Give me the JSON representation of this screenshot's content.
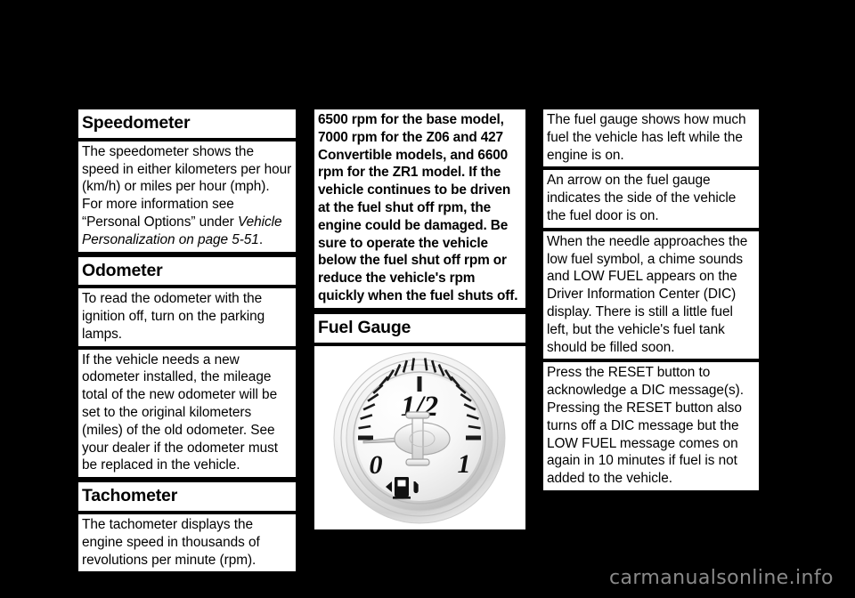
{
  "document": {
    "background_color": "#000000",
    "block_color": "#ffffff",
    "text_color": "#000000"
  },
  "columns": [
    {
      "id": "column-left",
      "blocks": [
        {
          "type": "heading",
          "text": "Speedometer"
        },
        {
          "type": "paragraph",
          "text": "The speedometer shows the speed in either kilometers per hour (km/h) or miles per hour (mph). For more information see “Personal Options” under ",
          "italic_text": "Vehicle Personalization on page 5-51",
          "text_after": "."
        },
        {
          "type": "heading",
          "text": "Odometer"
        },
        {
          "type": "paragraph",
          "text": "To read the odometer with the ignition off, turn on the parking lamps."
        },
        {
          "type": "paragraph",
          "text": "If the vehicle needs a new odometer installed, the mileage total of the new odometer will be set to the original kilometers (miles) of the old odometer. See your dealer if the odometer must be replaced in the vehicle."
        },
        {
          "type": "heading",
          "text": "Tachometer"
        },
        {
          "type": "paragraph",
          "text": "The tachometer displays the engine speed in thousands of revolutions per minute (rpm)."
        }
      ]
    },
    {
      "id": "column-center",
      "blocks": [
        {
          "type": "paragraph-bold",
          "text": "6500 rpm for the base model, 7000 rpm for the Z06 and 427 Convertible models, and 6600 rpm for the ZR1 model. If the vehicle continues to be driven at the fuel shut off rpm, the engine could be damaged. Be sure to operate the vehicle below the fuel shut off rpm or reduce the vehicle's rpm quickly when the fuel shuts off."
        },
        {
          "type": "heading",
          "text": "Fuel Gauge"
        },
        {
          "type": "figure",
          "name": "fuel-gauge-illustration"
        }
      ]
    },
    {
      "id": "column-right",
      "blocks": [
        {
          "type": "paragraph",
          "text": "The fuel gauge shows how much fuel the vehicle has left while the engine is on."
        },
        {
          "type": "paragraph",
          "text": "An arrow on the fuel gauge indicates the side of the vehicle the fuel door is on."
        },
        {
          "type": "paragraph",
          "text": "When the needle approaches the low fuel symbol, a chime sounds and LOW FUEL appears on the Driver Information Center (DIC) display. There is still a little fuel left, but the vehicle's fuel tank should be filled soon."
        },
        {
          "type": "paragraph",
          "text": "Press the RESET button to acknowledge a DIC message(s). Pressing the RESET button also turns off a DIC message but the LOW FUEL message comes on again in 10 minutes if fuel is not added to the vehicle."
        }
      ]
    }
  ],
  "figure": {
    "name": "fuel-gauge-illustration",
    "labels": {
      "empty": "0",
      "half": "1/2",
      "full": "1"
    },
    "low_fuel_icon": "fuel-pump-icon",
    "fuel_door_arrow": "left-arrow-icon",
    "needle_position": "empty"
  },
  "watermark": {
    "text": "carmanualsonline.info",
    "color": "#8a8a8a"
  }
}
